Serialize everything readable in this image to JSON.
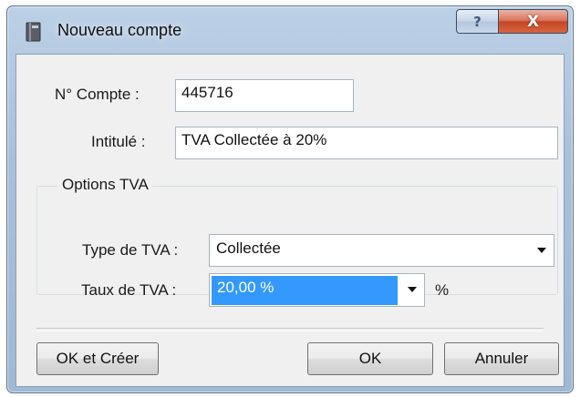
{
  "window": {
    "title": "Nouveau compte",
    "help_glyph": "?",
    "close_glyph": "X"
  },
  "form": {
    "account_number_label": "N° Compte :",
    "account_number_value": "445716",
    "title_label": "Intitulé :",
    "title_value": "TVA Collectée à 20%"
  },
  "vat_options": {
    "group_title": "Options TVA",
    "type_label": "Type de TVA :",
    "type_value": "Collectée",
    "rate_label": "Taux de TVA :",
    "rate_value": "20,00 %",
    "rate_unit": "%"
  },
  "buttons": {
    "ok_create": "OK et Créer",
    "ok": "OK",
    "cancel": "Annuler"
  },
  "colors": {
    "selection": "#3399ff",
    "close_button": "#c64625",
    "dialog_background": "#f0f0f0"
  }
}
